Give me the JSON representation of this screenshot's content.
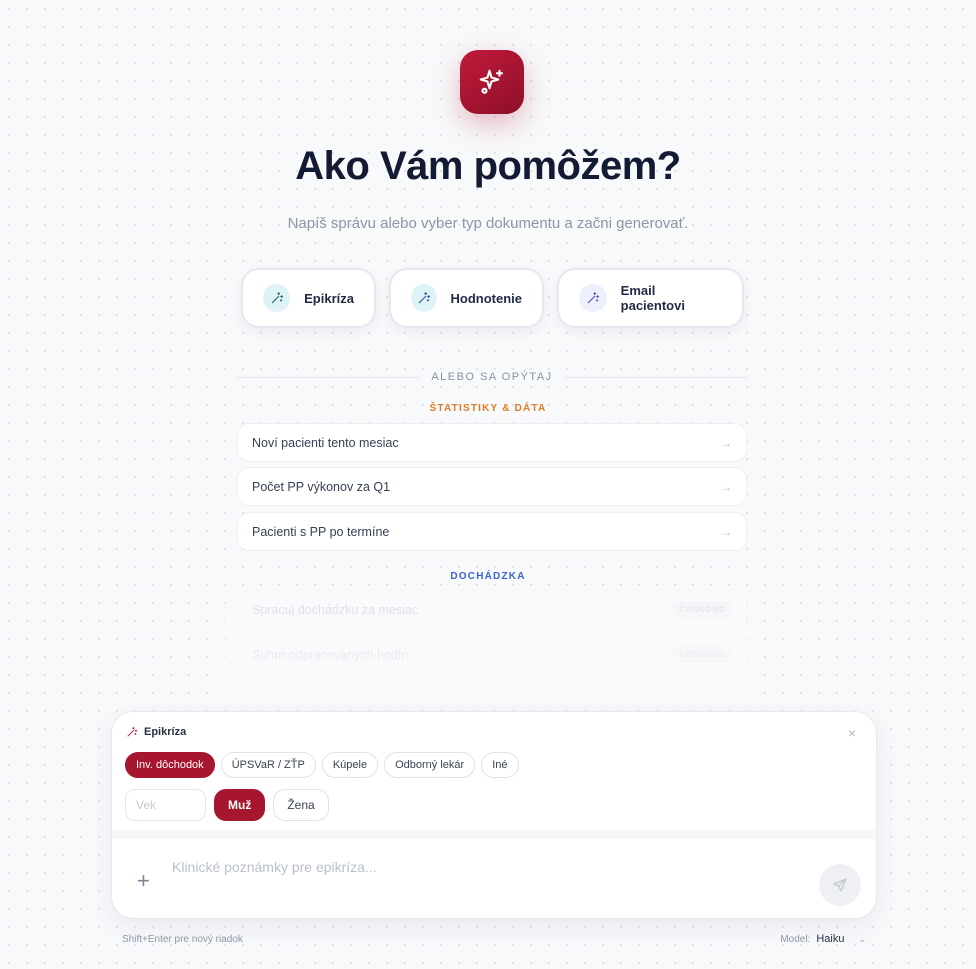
{
  "header": {
    "title": "Ako Vám pomôžem?",
    "subtitle": "Napíš správu alebo vyber typ dokumentu a začni generovať."
  },
  "doc_types": [
    {
      "label": "Epikríza",
      "icon": "magic-wand-icon",
      "color": "#dff3f6"
    },
    {
      "label": "Hodnotenie",
      "icon": "magic-wand-icon",
      "color": "#dff3f6"
    },
    {
      "label": "Email pacientovi",
      "icon": "magic-wand-icon",
      "color": "#eef0fb"
    }
  ],
  "divider_text": "ALEBO SA OPÝTAJ",
  "stats_section": {
    "label": "ŠTATISTIKY & DÁTA",
    "color": "#e07b24",
    "items": [
      "Noví pacienti tento mesiac",
      "Počet PP výkonov za Q1",
      "Pacienti s PP po termíne"
    ]
  },
  "attendance_section": {
    "label": "DOCHÁDZKA",
    "color": "#3b62d6",
    "items": [
      {
        "label": "Spracuj dochádzku za mesiac",
        "badge": "ČOSKORO"
      },
      {
        "label": "Suhrn odpracovaných hodín",
        "badge": "ČOSKORO"
      }
    ]
  },
  "composer": {
    "doc_type": "Epikríza",
    "categories": [
      "Inv. dôchodok",
      "ÚPSVaR / ZŤP",
      "Kúpele",
      "Odborný lekár",
      "Iné"
    ],
    "active_category": "Inv. dôchodok",
    "age_placeholder": "Vek",
    "genders": [
      "Muž",
      "Žena"
    ],
    "active_gender": "Muž",
    "notes_placeholder": "Klinické poznámky pre epikríza...",
    "accent": "#a6162e"
  },
  "footer": {
    "hint": "Shift+Enter pre nový riadok",
    "model_label": "Model:",
    "model_value": "Haiku"
  }
}
